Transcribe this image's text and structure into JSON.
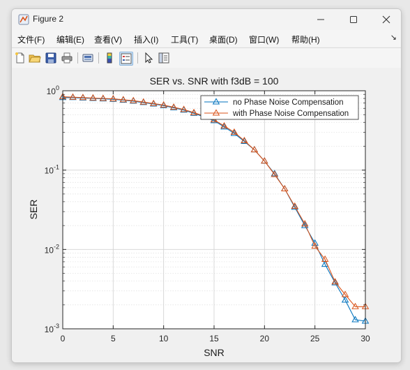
{
  "window": {
    "title": "Figure 2"
  },
  "menu": {
    "items": [
      "文件(F)",
      "编辑(E)",
      "查看(V)",
      "插入(I)",
      "工具(T)",
      "桌面(D)",
      "窗口(W)",
      "帮助(H)"
    ]
  },
  "toolbar": {
    "icons": [
      "new-file-icon",
      "open-folder-icon",
      "save-icon",
      "print-icon",
      "link-plot-icon",
      "colorbar-icon",
      "legend-icon",
      "pointer-icon",
      "property-editor-icon"
    ]
  },
  "chart_data": {
    "type": "line",
    "title": "SER vs. SNR with f3dB = 100",
    "xlabel": "SNR",
    "ylabel": "SER",
    "xlim": [
      0,
      30
    ],
    "ylim": [
      0.001,
      1
    ],
    "yscale": "log",
    "grid": true,
    "minor_grid": true,
    "xticks": [
      0,
      5,
      10,
      15,
      20,
      25,
      30
    ],
    "xtick_labels": [
      "0",
      "5",
      "10",
      "15",
      "20",
      "25",
      "30"
    ],
    "yticks": [
      0.001,
      0.01,
      0.1,
      1
    ],
    "ytick_labels": [
      {
        "base": "10",
        "exp": "-3"
      },
      {
        "base": "10",
        "exp": "-2"
      },
      {
        "base": "10",
        "exp": "-1"
      },
      {
        "base": "10",
        "exp": "0"
      }
    ],
    "legend_position": "top-right",
    "x": [
      0,
      1,
      2,
      3,
      4,
      5,
      6,
      7,
      8,
      9,
      10,
      11,
      12,
      13,
      14,
      15,
      16,
      17,
      18,
      19,
      20,
      21,
      22,
      23,
      24,
      25,
      26,
      27,
      28,
      29,
      30
    ],
    "series": [
      {
        "name": "no Phase Noise Compensation",
        "color": "#0072bd",
        "marker": "triangle",
        "values": [
          0.82,
          0.82,
          0.81,
          0.8,
          0.79,
          0.78,
          0.76,
          0.74,
          0.71,
          0.68,
          0.65,
          0.61,
          0.57,
          0.52,
          0.47,
          0.42,
          0.35,
          0.29,
          0.23,
          0.18,
          0.13,
          0.09,
          0.058,
          0.034,
          0.02,
          0.012,
          0.0065,
          0.0038,
          0.0023,
          0.0013,
          0.00125
        ]
      },
      {
        "name": "with Phase Noise Compensation",
        "color": "#d95319",
        "marker": "triangle",
        "values": [
          0.84,
          0.83,
          0.82,
          0.81,
          0.8,
          0.79,
          0.77,
          0.75,
          0.72,
          0.69,
          0.66,
          0.62,
          0.58,
          0.53,
          0.48,
          0.43,
          0.36,
          0.3,
          0.235,
          0.18,
          0.13,
          0.088,
          0.058,
          0.035,
          0.021,
          0.011,
          0.0075,
          0.0039,
          0.0027,
          0.0019,
          0.0019
        ]
      }
    ]
  }
}
